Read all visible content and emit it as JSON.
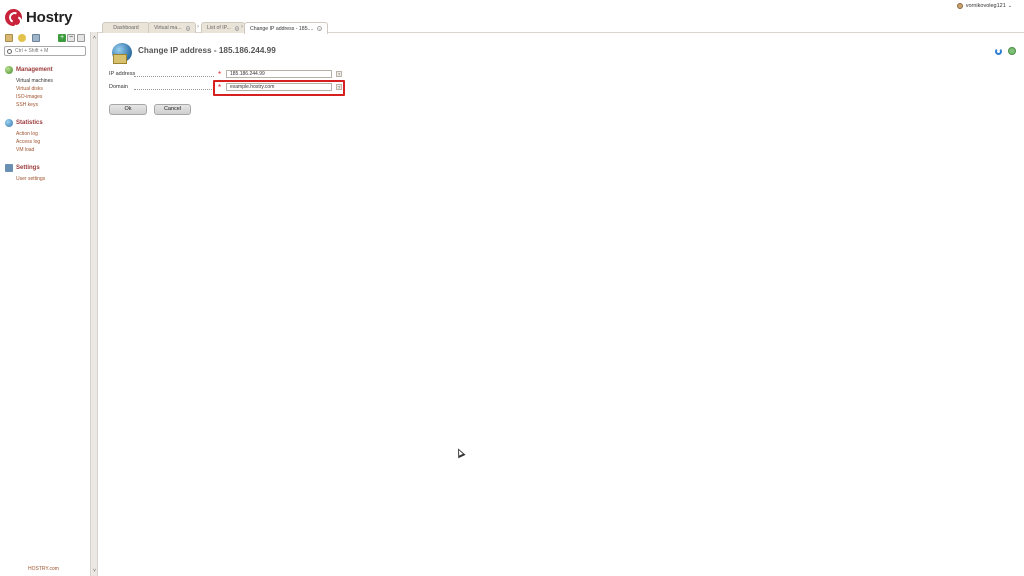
{
  "brand": {
    "name": "Hostry"
  },
  "user": {
    "name": "vornikovoleg121"
  },
  "sidebar": {
    "search_placeholder": "Ctrl + Shift + M",
    "sections": [
      {
        "title": "Management",
        "items": [
          "Virtual machines",
          "Virtual disks",
          "ISO-images",
          "SSH keys"
        ]
      },
      {
        "title": "Statistics",
        "items": [
          "Action log",
          "Access log",
          "VM load"
        ]
      },
      {
        "title": "Settings",
        "items": [
          "User settings"
        ]
      }
    ],
    "footer": "HOSTRY.com"
  },
  "tabs": [
    {
      "label": "Dashboard"
    },
    {
      "label": "Virtual ma..."
    },
    {
      "label": "List of IP..."
    },
    {
      "label": "Change IP address - 185...."
    }
  ],
  "page": {
    "title": "Change IP address - 185.186.244.99",
    "form": {
      "ip_label": "IP address",
      "ip_value": "185.186.244.99",
      "domain_label": "Domain",
      "domain_value": "example.hostry.com",
      "help_glyph": "?",
      "required_glyph": "*"
    },
    "buttons": {
      "ok": "Ok",
      "cancel": "Cancel"
    }
  },
  "colors": {
    "accent": "#9a3a3a",
    "link": "#a0522d",
    "highlight": "#d62020"
  }
}
